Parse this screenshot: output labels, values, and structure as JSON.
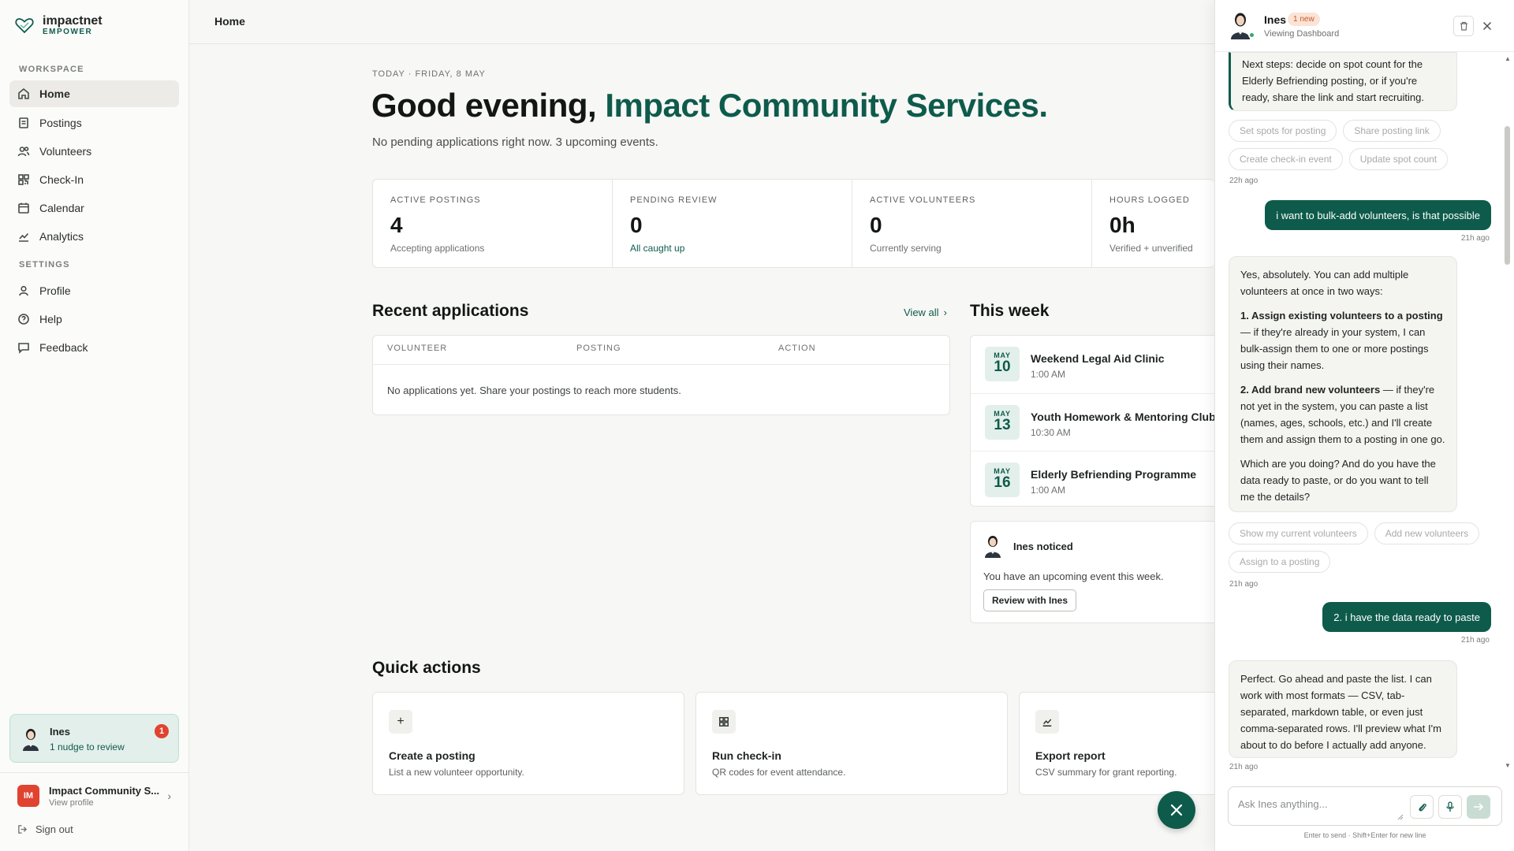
{
  "brand": {
    "name": "impactnet",
    "sub": "EMPOWER"
  },
  "sidebar": {
    "workspace_label": "WORKSPACE",
    "settings_label": "SETTINGS",
    "items": [
      {
        "label": "Home",
        "icon": "home-icon"
      },
      {
        "label": "Postings",
        "icon": "document-icon"
      },
      {
        "label": "Volunteers",
        "icon": "users-icon"
      },
      {
        "label": "Check-In",
        "icon": "qr-icon"
      },
      {
        "label": "Calendar",
        "icon": "calendar-icon"
      },
      {
        "label": "Analytics",
        "icon": "chart-icon"
      }
    ],
    "settings_items": [
      {
        "label": "Profile",
        "icon": "user-icon"
      },
      {
        "label": "Help",
        "icon": "help-icon"
      },
      {
        "label": "Feedback",
        "icon": "message-icon"
      }
    ],
    "nudge": {
      "name": "Ines",
      "sub": "1 nudge to review",
      "count": "1"
    },
    "org": {
      "initials": "IM",
      "name": "Impact Community S...",
      "sub": "View profile"
    },
    "signout": "Sign out"
  },
  "topbar": {
    "title": "Home"
  },
  "main": {
    "eyebrow": "TODAY · FRIDAY, 8 MAY",
    "greeting_prefix": "Good evening, ",
    "greeting_name": "Impact Community Services.",
    "subline": "No pending applications right now. 3 upcoming events.",
    "stats": [
      {
        "label": "ACTIVE POSTINGS",
        "value": "4",
        "sub": "Accepting applications"
      },
      {
        "label": "PENDING REVIEW",
        "value": "0",
        "sub": "All caught up"
      },
      {
        "label": "ACTIVE VOLUNTEERS",
        "value": "0",
        "sub": "Currently serving"
      },
      {
        "label": "HOURS LOGGED",
        "value": "0h",
        "sub": "Verified + unverified"
      }
    ],
    "recent": {
      "title": "Recent applications",
      "view_all": "View all",
      "columns": [
        "VOLUNTEER",
        "POSTING",
        "ACTION"
      ],
      "empty": "No applications yet. Share your postings to reach more students."
    },
    "week": {
      "title": "This week",
      "events": [
        {
          "month": "MAY",
          "day": "10",
          "title": "Weekend Legal Aid Clinic",
          "time": "1:00 AM"
        },
        {
          "month": "MAY",
          "day": "13",
          "title": "Youth Homework & Mentoring Club",
          "time": "10:30 AM"
        },
        {
          "month": "MAY",
          "day": "16",
          "title": "Elderly Befriending Programme",
          "time": "1:00 AM"
        }
      ]
    },
    "noticed": {
      "title": "Ines noticed",
      "text": "You have an upcoming event this week.",
      "button": "Review with Ines"
    },
    "quick_actions": {
      "title": "Quick actions",
      "items": [
        {
          "icon": "plus-icon",
          "title": "Create a posting",
          "sub": "List a new volunteer opportunity."
        },
        {
          "icon": "qr-icon",
          "title": "Run check-in",
          "sub": "QR codes for event attendance."
        },
        {
          "icon": "chart-icon",
          "title": "Export report",
          "sub": "CSV summary for grant reporting."
        }
      ]
    }
  },
  "chat": {
    "name": "Ines",
    "badge": "1 new",
    "status": "Viewing Dashboard",
    "messages": {
      "m1": "Next steps: decide on spot count for the Elderly Befriending posting, or if you're ready, share the link and start recruiting.",
      "chips1": [
        "Set spots for posting",
        "Share posting link",
        "Create check-in event",
        "Update spot count"
      ],
      "t1": "22h ago",
      "u1": "i want to bulk-add volunteers, is that possible",
      "t2": "21h ago",
      "m2_p1": "Yes, absolutely. You can add multiple volunteers at once in two ways:",
      "m2_p2_bold": "1. Assign existing volunteers to a posting",
      "m2_p2_rest": " — if they're already in your system, I can bulk-assign them to one or more postings using their names.",
      "m2_p3_bold": "2. Add brand new volunteers",
      "m2_p3_rest": " — if they're not yet in the system, you can paste a list (names, ages, schools, etc.) and I'll create them and assign them to a posting in one go.",
      "m2_p4": "Which are you doing? And do you have the data ready to paste, or do you want to tell me the details?",
      "chips2": [
        "Show my current volunteers",
        "Add new volunteers",
        "Assign to a posting"
      ],
      "t3": "21h ago",
      "u2": "2. i have the data ready to paste",
      "t4": "21h ago",
      "m3": "Perfect. Go ahead and paste the list. I can work with most formats — CSV, tab-separated, markdown table, or even just comma-separated rows. I'll preview what I'm about to do before I actually add anyone.",
      "t5": "21h ago"
    },
    "composer_placeholder": "Ask Ines anything...",
    "hint": "Enter to send · Shift+Enter for new line"
  },
  "colors": {
    "accent": "#0e5b4c",
    "badge": "#e0432f"
  }
}
